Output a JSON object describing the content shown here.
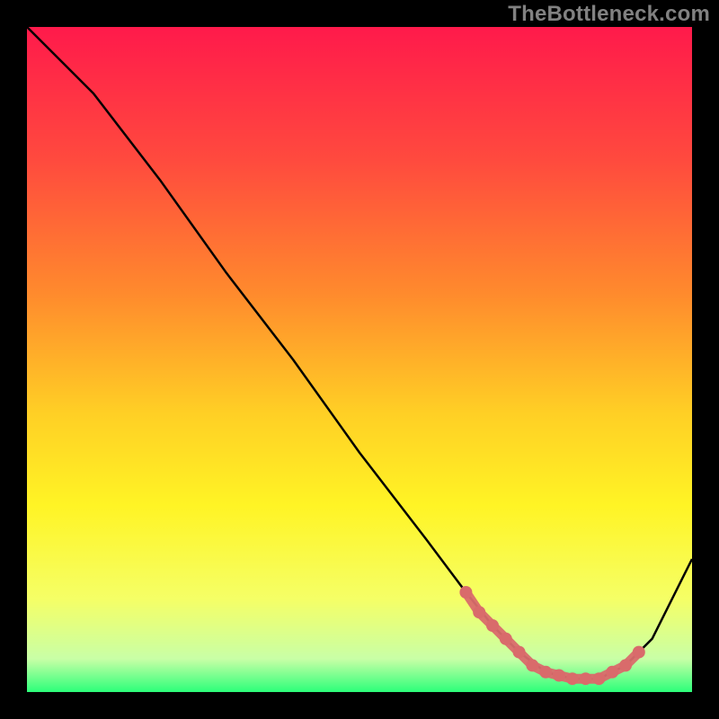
{
  "watermark": "TheBottleneck.com",
  "chart_data": {
    "type": "line",
    "title": "",
    "xlabel": "",
    "ylabel": "",
    "xlim": [
      0,
      100
    ],
    "ylim": [
      0,
      100
    ],
    "background_gradient": {
      "orientation": "vertical",
      "stops": [
        {
          "pos": 0.0,
          "color": "#ff1a4b"
        },
        {
          "pos": 0.2,
          "color": "#ff4a3e"
        },
        {
          "pos": 0.4,
          "color": "#ff8a2d"
        },
        {
          "pos": 0.58,
          "color": "#ffcf25"
        },
        {
          "pos": 0.72,
          "color": "#fff425"
        },
        {
          "pos": 0.86,
          "color": "#f5ff66"
        },
        {
          "pos": 0.95,
          "color": "#c9ffa6"
        },
        {
          "pos": 1.0,
          "color": "#2cff7a"
        }
      ]
    },
    "series": [
      {
        "name": "bottleneck-curve",
        "color": "#000000",
        "x": [
          0,
          6,
          10,
          20,
          30,
          40,
          50,
          60,
          66,
          70,
          74,
          78,
          82,
          86,
          90,
          94,
          100
        ],
        "y": [
          100,
          94,
          90,
          77,
          63,
          50,
          36,
          23,
          15,
          10,
          6,
          3,
          2,
          2,
          4,
          8,
          20
        ]
      }
    ],
    "markers": {
      "name": "optimal-band",
      "color": "#d96b6b",
      "x": [
        66,
        68,
        70,
        72,
        74,
        76,
        78,
        80,
        82,
        84,
        86,
        88,
        90,
        92
      ],
      "y": [
        15,
        12,
        10,
        8,
        6,
        4,
        3,
        2.5,
        2,
        2,
        2,
        3,
        4,
        6
      ]
    }
  }
}
